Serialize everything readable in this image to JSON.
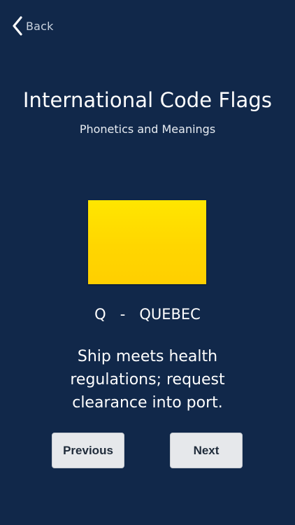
{
  "nav": {
    "back_label": "Back",
    "back_icon": "chevron-left-icon"
  },
  "header": {
    "title": "International Code Flags",
    "subtitle": "Phonetics and Meanings"
  },
  "flag": {
    "letter": "Q",
    "separator": "-",
    "word": "QUEBEC",
    "color": "#ffe000",
    "meaning": "Ship meets health regulations; request clearance into port."
  },
  "controls": {
    "previous_label": "Previous",
    "next_label": "Next"
  },
  "colors": {
    "background": "#11284a",
    "button": "#e6e8eb"
  }
}
